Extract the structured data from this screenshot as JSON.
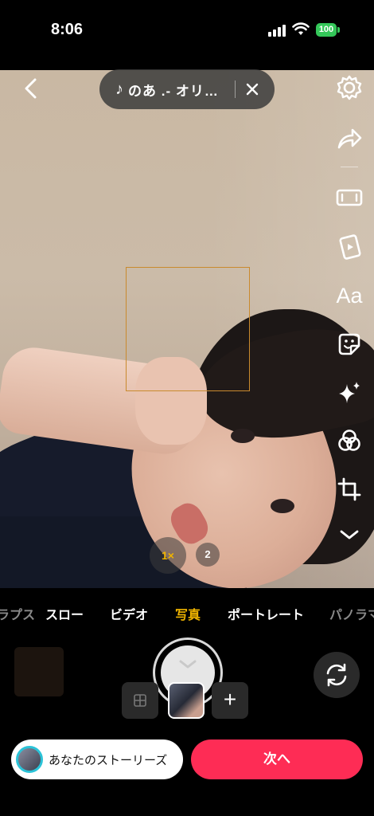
{
  "status_bar": {
    "time": "8:06",
    "battery": "100",
    "battery_color": "#34c759"
  },
  "music": {
    "title": "のあ .- オリ…"
  },
  "zoom": {
    "one": "1×",
    "two": "2"
  },
  "modes": [
    {
      "label": "ラプス"
    },
    {
      "label": "スロー"
    },
    {
      "label": "ビデオ"
    },
    {
      "label": "写真"
    },
    {
      "label": "ポートレート"
    },
    {
      "label": "パノラマ"
    }
  ],
  "active_mode": "写真",
  "right_tools": [
    "settings-gear-icon",
    "share-arrow-icon",
    "aspect-ratio-icon",
    "video-clips-icon",
    "text-tool",
    "sticker-icon",
    "effects-sparkle-icon",
    "filters-icon",
    "crop-icon",
    "chevron-down-icon"
  ],
  "text_tool_label": "Aa",
  "footer": {
    "story_label": "あなたのストーリーズ",
    "next_label": "次へ",
    "accent": "#fe2c55"
  }
}
